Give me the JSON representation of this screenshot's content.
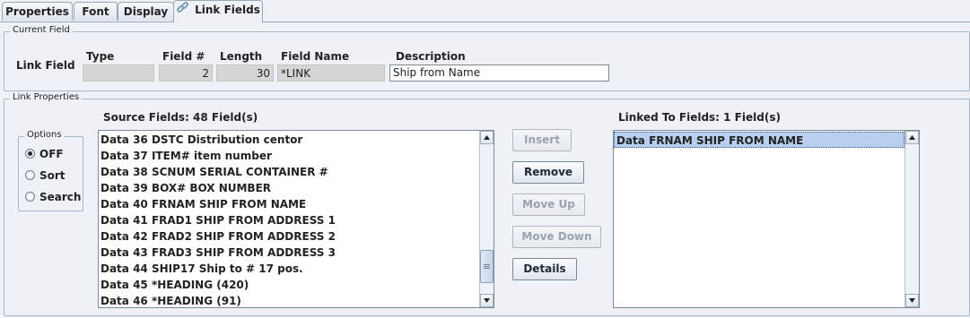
{
  "tabs": [
    {
      "label": "Properties"
    },
    {
      "label": "Font"
    },
    {
      "label": "Display"
    },
    {
      "label": "Link Fields",
      "active": true,
      "icon": "link-icon"
    }
  ],
  "current_field": {
    "group_title": "Current Field",
    "row_label": "Link Field",
    "type_label": "Type",
    "type_value": "",
    "fieldnum_label": "Field #",
    "fieldnum_value": "2",
    "length_label": "Length",
    "length_value": "30",
    "fieldname_label": "Field Name",
    "fieldname_value": "*LINK",
    "description_label": "Description",
    "description_value": "Ship from Name"
  },
  "link_properties": {
    "group_title": "Link Properties",
    "options": {
      "title": "Options",
      "items": [
        {
          "label": "OFF",
          "checked": true
        },
        {
          "label": "Sort",
          "checked": false
        },
        {
          "label": "Search",
          "checked": false
        }
      ]
    },
    "source": {
      "heading": "Source Fields: 48 Field(s)",
      "items": [
        "Data 36 DSTC Distribution centor",
        "Data 37 ITEM# item number",
        "Data 38 SCNUM SERIAL CONTAINER #",
        "Data 39 BOX# BOX NUMBER",
        "Data 40 FRNAM SHIP FROM NAME",
        "Data 41 FRAD1 SHIP FROM ADDRESS 1",
        "Data 42 FRAD2 SHIP FROM ADDRESS 2",
        "Data 43 FRAD3 SHIP FROM ADDRESS 3",
        "Data 44 SHIP17 Ship to # 17 pos.",
        "Data 45 *HEADING (420)",
        "Data 46 *HEADING (91)"
      ]
    },
    "buttons": {
      "insert": "Insert",
      "remove": "Remove",
      "move_up": "Move Up",
      "move_down": "Move Down",
      "details": "Details"
    },
    "linked": {
      "heading": "Linked To Fields: 1 Field(s)",
      "items": [
        "Data FRNAM SHIP FROM NAME"
      ]
    }
  }
}
